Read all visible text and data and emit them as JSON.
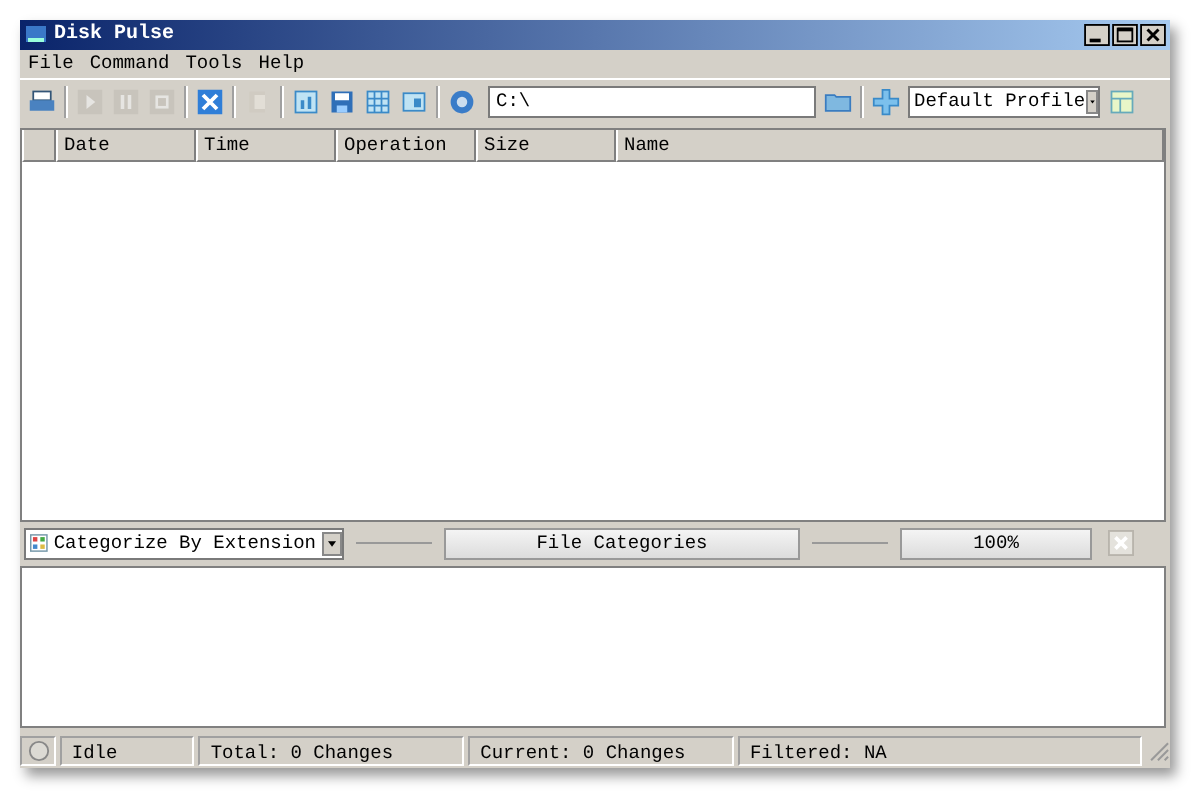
{
  "window": {
    "title": "Disk Pulse"
  },
  "menu": [
    "File",
    "Command",
    "Tools",
    "Help"
  ],
  "toolbar": [
    {
      "kind": "printer",
      "disabled": false
    },
    {
      "kind": "sep"
    },
    {
      "kind": "play",
      "disabled": true
    },
    {
      "kind": "pause",
      "disabled": true
    },
    {
      "kind": "stop",
      "disabled": true
    },
    {
      "kind": "sep"
    },
    {
      "kind": "clear",
      "disabled": false
    },
    {
      "kind": "sep"
    },
    {
      "kind": "copy",
      "disabled": true
    },
    {
      "kind": "sep"
    },
    {
      "kind": "chart",
      "disabled": false
    },
    {
      "kind": "save",
      "disabled": false
    },
    {
      "kind": "grid",
      "disabled": false
    },
    {
      "kind": "report",
      "disabled": false
    },
    {
      "kind": "sep"
    },
    {
      "kind": "help",
      "disabled": false
    }
  ],
  "path": {
    "value": "C:\\"
  },
  "profile": {
    "value": "Default Profile"
  },
  "table": {
    "columns": [
      "Date",
      "Time",
      "Operation",
      "Size",
      "Name"
    ]
  },
  "category_bar": {
    "select": "Categorize By Extension",
    "button": "File Categories",
    "percent": "100%"
  },
  "status_bar": [
    "Idle",
    "Total: 0 Changes",
    "Current: 0 Changes",
    "Filtered: NA"
  ]
}
